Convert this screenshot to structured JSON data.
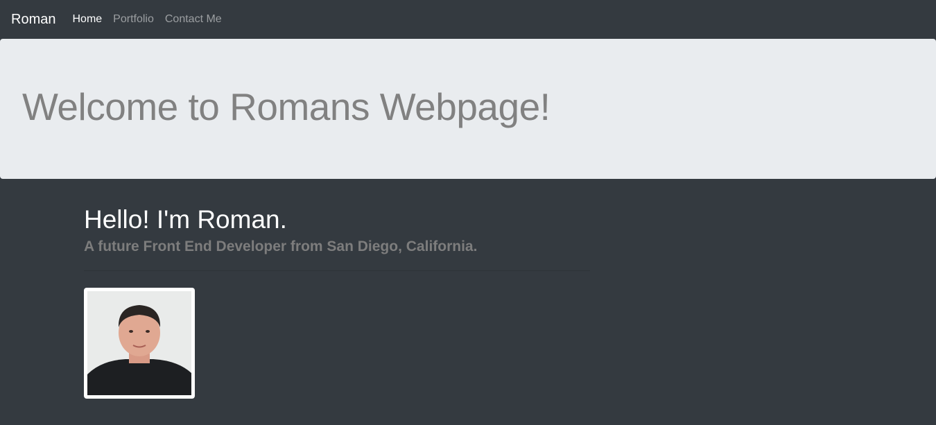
{
  "navbar": {
    "brand": "Roman",
    "links": [
      {
        "label": "Home",
        "active": true
      },
      {
        "label": "Portfolio",
        "active": false
      },
      {
        "label": "Contact Me",
        "active": false
      }
    ]
  },
  "jumbotron": {
    "title": "Welcome to Romans Webpage!"
  },
  "about": {
    "heading": "Hello! I'm Roman.",
    "subtitle": "A future Front End Developer from San Diego, California."
  },
  "colors": {
    "background": "#343a40",
    "jumbotron": "#e9ecef",
    "title_text": "#818181",
    "subtitle_text": "#7d7d7d"
  }
}
